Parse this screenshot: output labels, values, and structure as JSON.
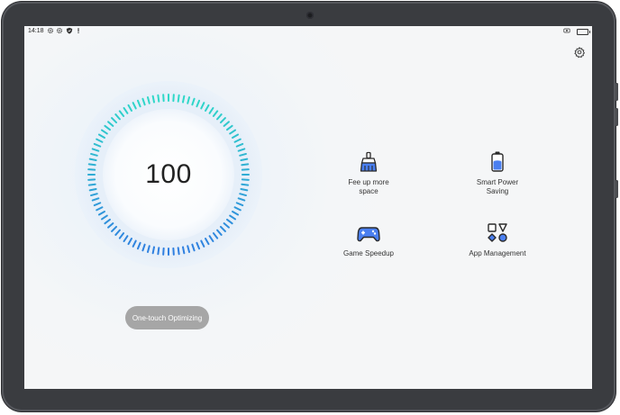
{
  "status_bar": {
    "time": "14:18",
    "left_icons": [
      "settings-gear-icon",
      "settings-gear-icon",
      "shield-icon",
      "notification-dot-icon"
    ],
    "right_icons": [
      "screen-record-icon",
      "battery-icon"
    ]
  },
  "header": {
    "settings_icon": "gear-icon"
  },
  "dial": {
    "score": "100",
    "progress_fraction": 1.0,
    "colors": {
      "top": "#2fd8c8",
      "bottom": "#2f7fe0",
      "ring_bg": "#dbe8f6"
    }
  },
  "actions": {
    "optimize_button": "One-touch Optimizing"
  },
  "tools": [
    {
      "label_lines": [
        "Fee up more",
        "space"
      ],
      "icon": "broom-icon"
    },
    {
      "label_lines": [
        "Smart Power",
        "Saving"
      ],
      "icon": "battery-icon"
    },
    {
      "label_lines": [
        "Game Speedup"
      ],
      "icon": "gamepad-icon"
    },
    {
      "label_lines": [
        "App Management"
      ],
      "icon": "app-grid-icon"
    }
  ]
}
